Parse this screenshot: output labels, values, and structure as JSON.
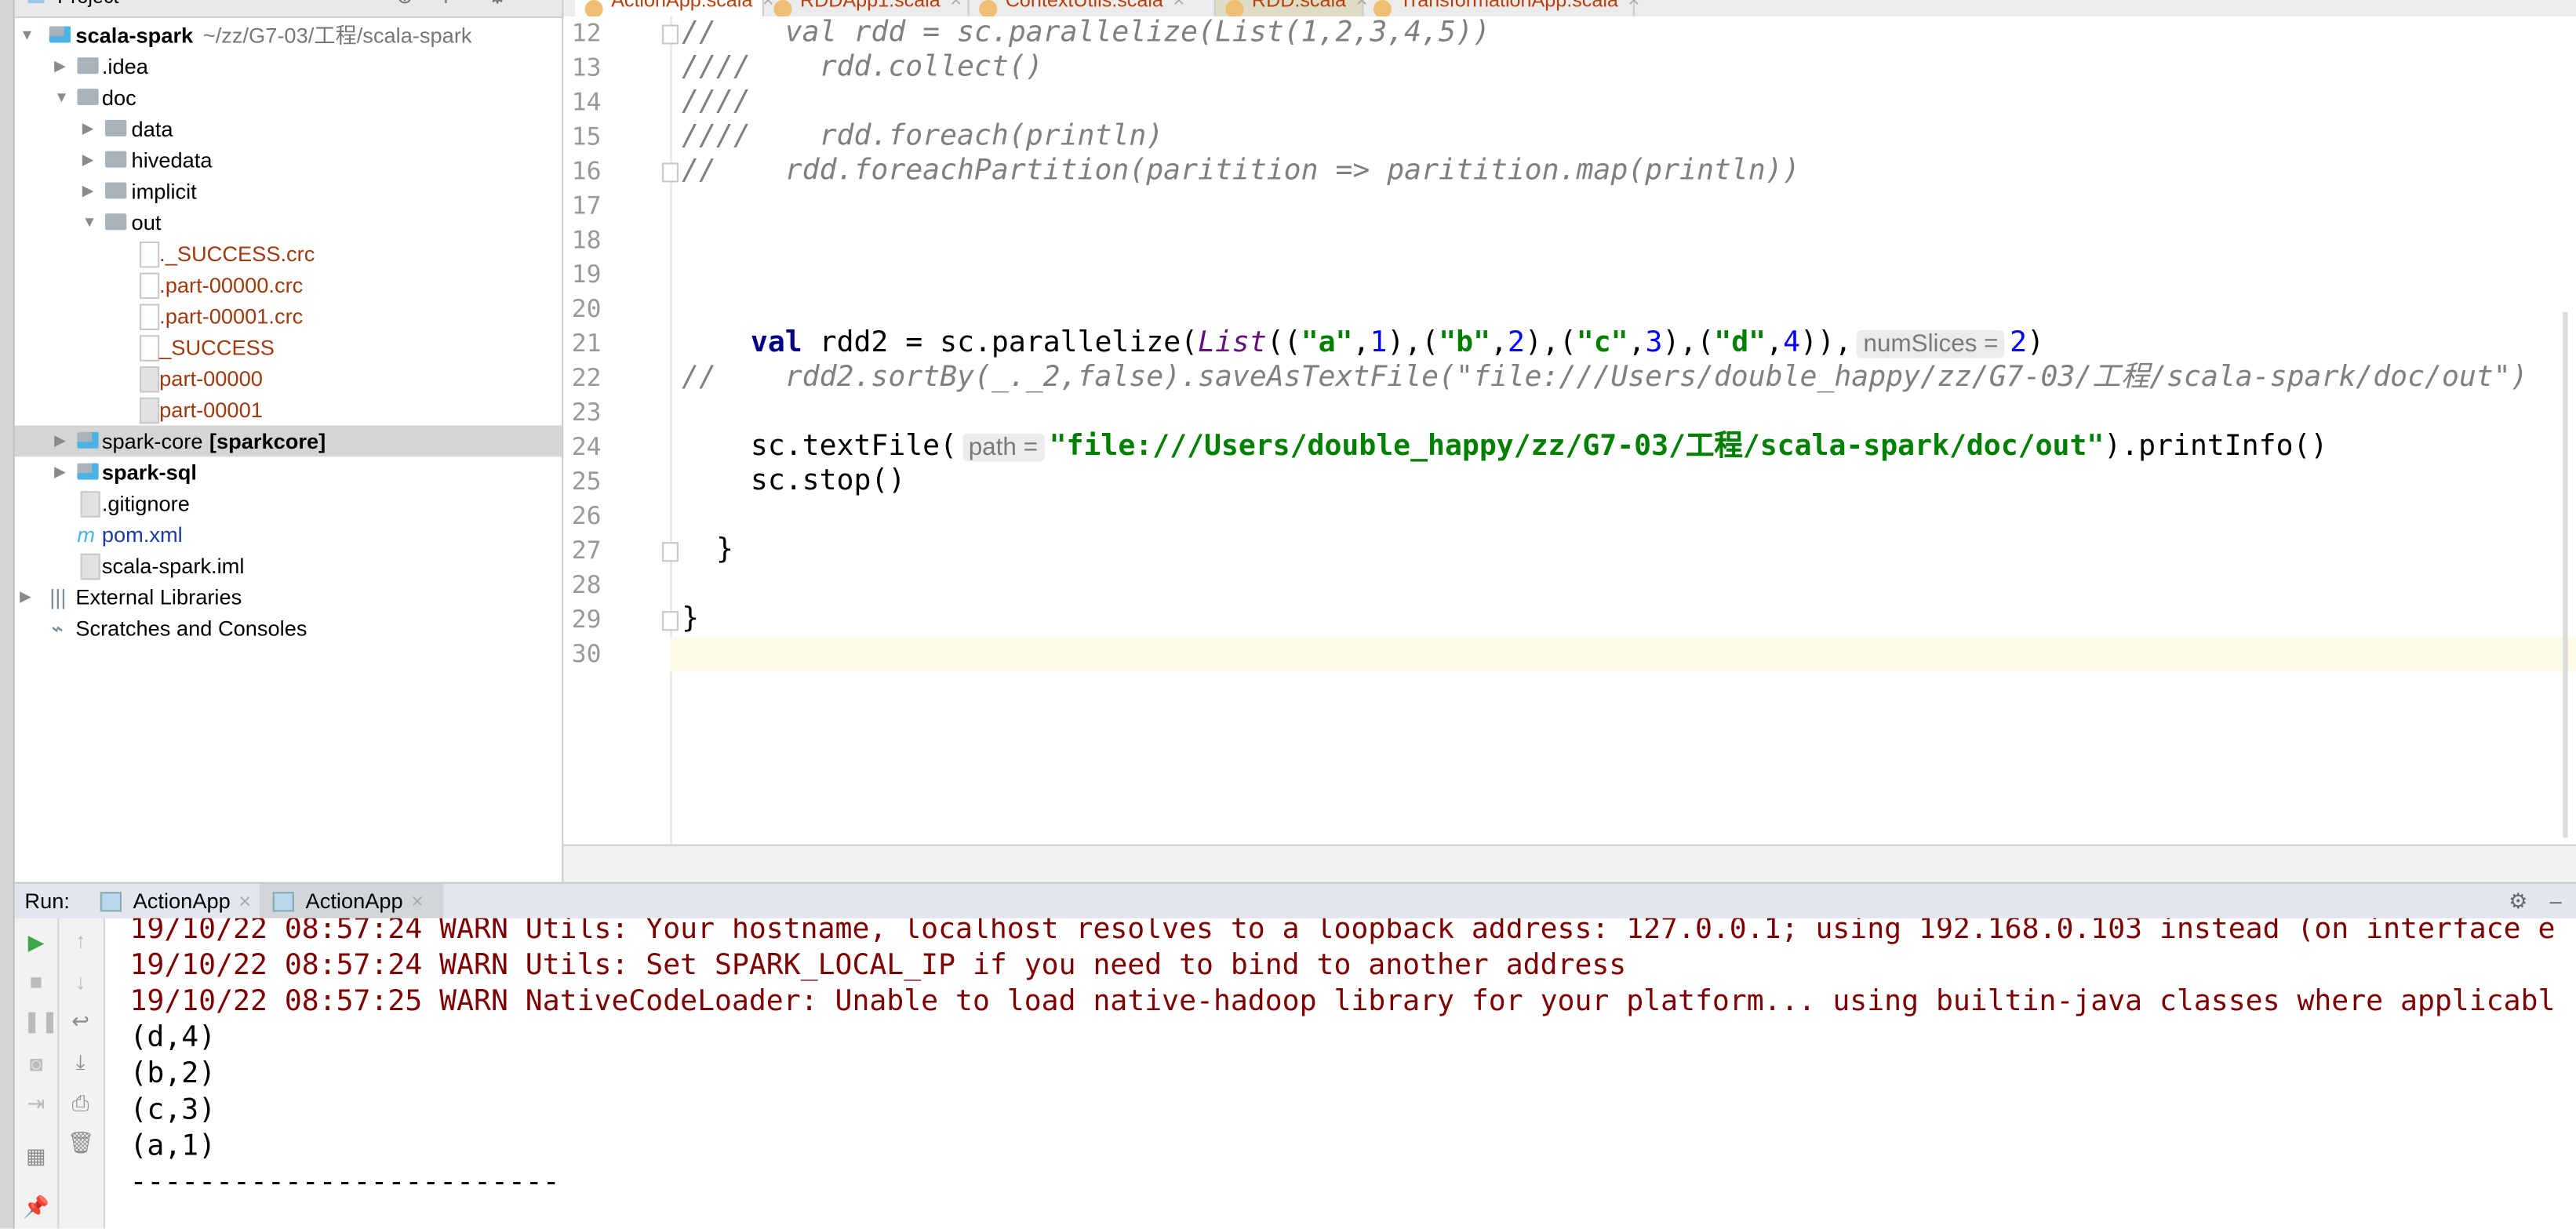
{
  "project_panel": {
    "title": "Project",
    "tree": [
      {
        "label": "scala-spark",
        "suffix": "~/zz/G7-03/工程/scala-spark",
        "depth": 0,
        "expanded": true,
        "kind": "module",
        "bold": true
      },
      {
        "label": ".idea",
        "depth": 1,
        "expanded": false,
        "kind": "folder"
      },
      {
        "label": "doc",
        "depth": 1,
        "expanded": true,
        "kind": "folder"
      },
      {
        "label": "data",
        "depth": 2,
        "expanded": false,
        "kind": "folder"
      },
      {
        "label": "hivedata",
        "depth": 2,
        "expanded": false,
        "kind": "folder"
      },
      {
        "label": "implicit",
        "depth": 2,
        "expanded": false,
        "kind": "folder"
      },
      {
        "label": "out",
        "depth": 2,
        "expanded": true,
        "kind": "folder"
      },
      {
        "label": "._SUCCESS.crc",
        "depth": 3,
        "kind": "file",
        "color": "#a0390e"
      },
      {
        "label": ".part-00000.crc",
        "depth": 3,
        "kind": "file",
        "color": "#a0390e"
      },
      {
        "label": ".part-00001.crc",
        "depth": 3,
        "kind": "file",
        "color": "#a0390e"
      },
      {
        "label": "_SUCCESS",
        "depth": 3,
        "kind": "file",
        "color": "#a0390e"
      },
      {
        "label": "part-00000",
        "depth": 3,
        "kind": "textfile",
        "color": "#a0390e"
      },
      {
        "label": "part-00001",
        "depth": 3,
        "kind": "textfile",
        "color": "#a0390e"
      },
      {
        "label": "spark-core",
        "bold_suffix": "[sparkcore]",
        "depth": 1,
        "expanded": false,
        "kind": "module",
        "selected": true
      },
      {
        "label": "spark-sql",
        "depth": 1,
        "expanded": false,
        "kind": "module",
        "bold": true
      },
      {
        "label": ".gitignore",
        "depth": 1,
        "kind": "textfile"
      },
      {
        "label": "pom.xml",
        "depth": 1,
        "kind": "maven",
        "color": "#1d3ba0"
      },
      {
        "label": "scala-spark.iml",
        "depth": 1,
        "kind": "textfile"
      },
      {
        "label": "External Libraries",
        "depth": 0,
        "expanded": false,
        "kind": "libraries"
      },
      {
        "label": "Scratches and Consoles",
        "depth": 0,
        "kind": "scratches"
      }
    ]
  },
  "editor_tabs": [
    {
      "label": "ActionApp.scala",
      "active": true
    },
    {
      "label": "RDDApp1.scala"
    },
    {
      "label": "ContextUtils.scala"
    },
    {
      "label": "RDD.scala"
    },
    {
      "label": "TransformationApp.scala"
    }
  ],
  "editor": {
    "first_line": 12,
    "current_line": 30,
    "lines": [
      [
        {
          "c": "cm",
          "t": "//    val rdd = sc.parallelize(List(1,2,3,4,5))"
        }
      ],
      [
        {
          "c": "cm",
          "t": "////    rdd.collect()"
        }
      ],
      [
        {
          "c": "cm",
          "t": "////"
        }
      ],
      [
        {
          "c": "cm",
          "t": "////    rdd.foreach(println)"
        }
      ],
      [
        {
          "c": "cm",
          "t": "//    rdd.foreachPartition(paritition => paritition.map(println))"
        }
      ],
      [],
      [],
      [],
      [],
      [
        {
          "c": "",
          "t": "    "
        },
        {
          "c": "kw",
          "t": "val"
        },
        {
          "c": "",
          "t": " rdd2 = sc.parallelize("
        },
        {
          "c": "ty",
          "t": "List"
        },
        {
          "c": "",
          "t": "(("
        },
        {
          "c": "str",
          "t": "\"a\""
        },
        {
          "c": "",
          "t": ","
        },
        {
          "c": "num",
          "t": "1"
        },
        {
          "c": "",
          "t": "),("
        },
        {
          "c": "str",
          "t": "\"b\""
        },
        {
          "c": "",
          "t": ","
        },
        {
          "c": "num",
          "t": "2"
        },
        {
          "c": "",
          "t": "),("
        },
        {
          "c": "str",
          "t": "\"c\""
        },
        {
          "c": "",
          "t": ","
        },
        {
          "c": "num",
          "t": "3"
        },
        {
          "c": "",
          "t": "),("
        },
        {
          "c": "str",
          "t": "\"d\""
        },
        {
          "c": "",
          "t": ","
        },
        {
          "c": "num",
          "t": "4"
        },
        {
          "c": "",
          "t": ")),"
        },
        {
          "c": "hint",
          "t": "numSlices ="
        },
        {
          "c": "num",
          "t": "2"
        },
        {
          "c": "",
          "t": ")"
        }
      ],
      [
        {
          "c": "cm",
          "t": "//    rdd2.sortBy(_._2,false).saveAsTextFile(\"file:///Users/double_happy/zz/G7-03/工程/scala-spark/doc/out\")"
        }
      ],
      [],
      [
        {
          "c": "",
          "t": "    sc.textFile("
        },
        {
          "c": "hint",
          "t": "path ="
        },
        {
          "c": "str",
          "t": "\"file:///Users/double_happy/zz/G7-03/工程/scala-spark/doc/out\""
        },
        {
          "c": "",
          "t": ").printInfo()"
        }
      ],
      [
        {
          "c": "",
          "t": "    sc.stop()"
        }
      ],
      [],
      [
        {
          "c": "",
          "t": "  }"
        }
      ],
      [],
      [
        {
          "c": "",
          "t": "}"
        }
      ],
      []
    ],
    "fold_lines": [
      12,
      16,
      27,
      29
    ]
  },
  "run_panel": {
    "label": "Run:",
    "tabs": [
      {
        "label": "ActionApp"
      },
      {
        "label": "ActionApp",
        "active": true
      }
    ],
    "output": [
      {
        "type": "warn",
        "text": "19/10/22 08:57:24 WARN Utils: Your hostname, localhost resolves to a loopback address: 127.0.0.1; using 192.168.0.103 instead (on interface e"
      },
      {
        "type": "warn",
        "text": "19/10/22 08:57:24 WARN Utils: Set SPARK_LOCAL_IP if you need to bind to another address"
      },
      {
        "type": "warn",
        "text": "19/10/22 08:57:25 WARN NativeCodeLoader: Unable to load native-hadoop library for your platform... using builtin-java classes where applicabl"
      },
      {
        "type": "out",
        "text": "(d,4)"
      },
      {
        "type": "out",
        "text": "(b,2)"
      },
      {
        "type": "out",
        "text": "(c,3)"
      },
      {
        "type": "out",
        "text": "(a,1)"
      },
      {
        "type": "out",
        "text": "-------------------------"
      }
    ]
  },
  "colors": {
    "warn": "#7f0000",
    "string": "#008000",
    "keyword": "#000080",
    "number": "#0000ff",
    "comment": "#808080",
    "current_line": "#fdfae6"
  }
}
